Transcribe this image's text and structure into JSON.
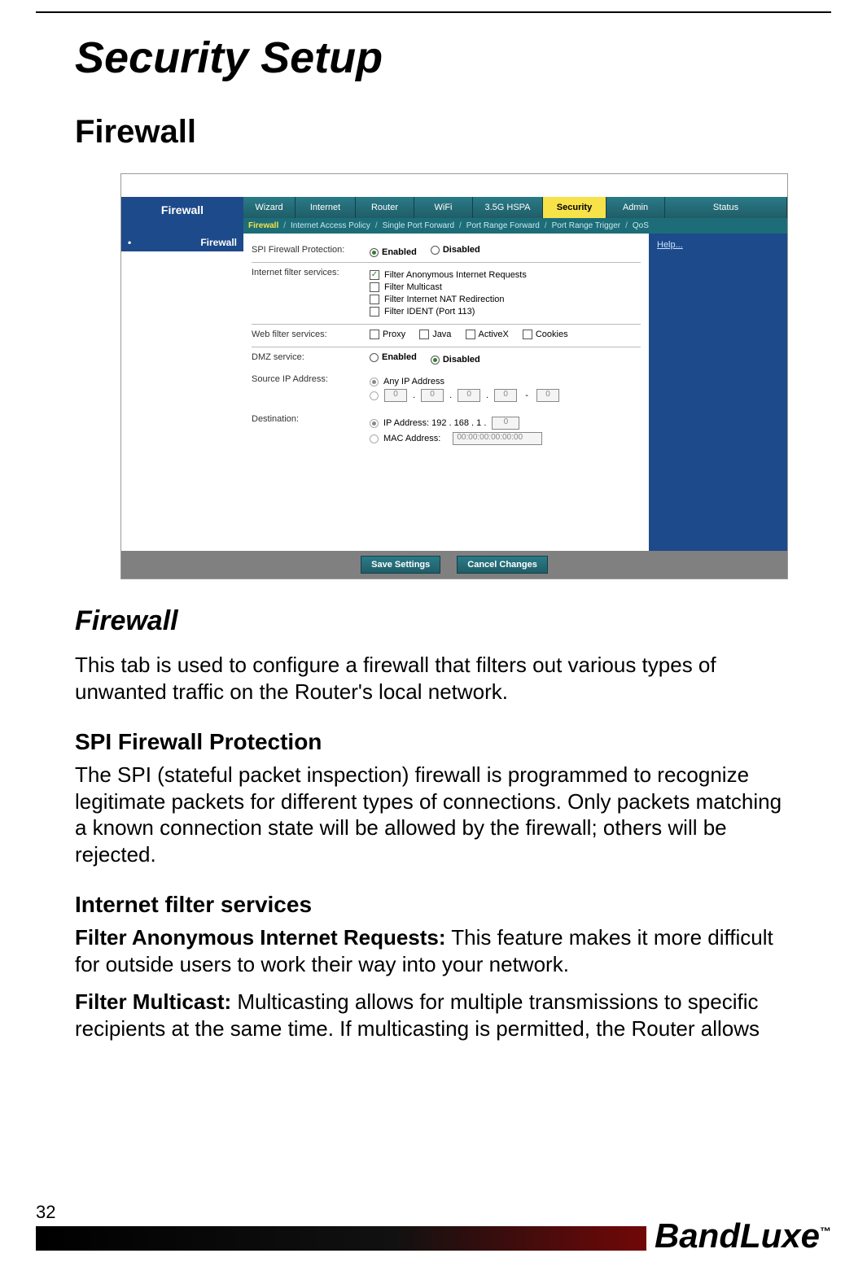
{
  "page": {
    "title": "Security Setup",
    "section": "Firewall",
    "subhead": "Firewall",
    "intro": "This tab is used to configure a firewall that filters out various types of unwanted traffic on the Router's local network.",
    "spi_h": "SPI Firewall Protection",
    "spi_p": "The SPI (stateful packet inspection) firewall is programmed to recognize legitimate packets for different types of connections. Only packets matching a known connection state will be allowed by the firewall; others will be rejected.",
    "ifs_h": "Internet filter services",
    "ifs_p1_lead": "Filter Anonymous Internet Requests:",
    "ifs_p1_rest": " This feature makes it more difficult for outside users to work their way into your network.",
    "ifs_p2_lead": "Filter Multicast:",
    "ifs_p2_rest": " Multicasting allows for multiple transmissions to specific recipients at the same time. If multicasting is permitted, the Router allows",
    "page_number": "32",
    "brand": "BandLuxe",
    "brand_tm": "™"
  },
  "ui": {
    "sidebar_title": "Firewall",
    "side_current": "Firewall",
    "tabs": [
      "Wizard",
      "Internet",
      "Router",
      "WiFi",
      "3.5G HSPA",
      "Security",
      "Admin",
      "Status"
    ],
    "tab_selected": "Security",
    "subtabs": [
      "Firewall",
      "Internet Access Policy",
      "Single Port Forward",
      "Port Range Forward",
      "Port Range Trigger",
      "QoS"
    ],
    "subtab_selected": "Firewall",
    "help": "Help...",
    "rows": {
      "spi_label": "SPI Firewall Protection:",
      "spi_enabled": "Enabled",
      "spi_disabled": "Disabled",
      "ifs_label": "Internet filter services:",
      "ifs_1": "Filter Anonymous Internet Requests",
      "ifs_2": "Filter Multicast",
      "ifs_3": "Filter Internet NAT Redirection",
      "ifs_4": "Filter IDENT (Port 113)",
      "wfs_label": "Web filter services:",
      "wfs_1": "Proxy",
      "wfs_2": "Java",
      "wfs_3": "ActiveX",
      "wfs_4": "Cookies",
      "dmz_label": "DMZ service:",
      "dmz_enabled": "Enabled",
      "dmz_disabled": "Disabled",
      "src_label": "Source IP Address:",
      "src_any": "Any IP Address",
      "dst_label": "Destination:",
      "dst_ip_prefix": "IP Address: 192 . 168 . 1 .",
      "dst_ip_last": "0",
      "dst_mac_label": "MAC Address:",
      "dst_mac_value": "00:00:00:00:00:00",
      "ip_oct": "0"
    },
    "buttons": {
      "save": "Save Settings",
      "cancel": "Cancel Changes"
    }
  }
}
